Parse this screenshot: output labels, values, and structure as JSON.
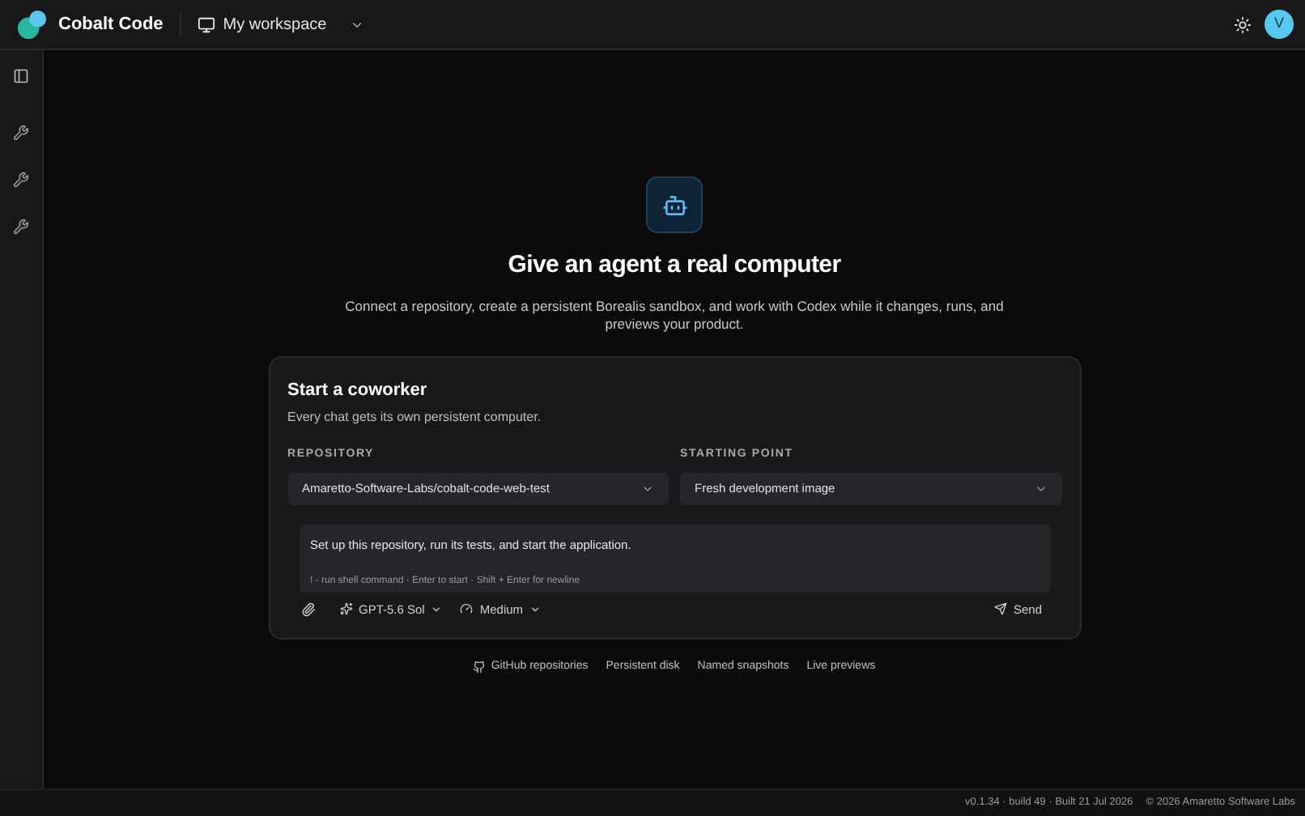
{
  "header": {
    "app_name": "Cobalt Code",
    "workspace": "My workspace",
    "avatar": "V"
  },
  "hero": {
    "title": "Give an agent a real computer",
    "subtitle": "Connect a repository, create a persistent Borealis sandbox, and work with Codex while it changes, runs, and previews your product."
  },
  "card": {
    "title": "Start a coworker",
    "subtitle": "Every chat gets its own persistent computer.",
    "fields": [
      {
        "label": "REPOSITORY",
        "value": "Amaretto-Software-Labs/cobalt-code-web-test"
      },
      {
        "label": "STARTING POINT",
        "value": "Fresh development image"
      }
    ],
    "prompt": {
      "value": "Set up this repository, run its tests, and start the application.",
      "hint": "! - run shell command · Enter to start · Shift + Enter for newline"
    },
    "model": "GPT-5.6 Sol",
    "effort": "Medium",
    "send": "Send"
  },
  "features": [
    {
      "label": "GitHub repositories",
      "kind": "github"
    },
    {
      "label": "Persistent disk",
      "kind": "plain"
    },
    {
      "label": "Named snapshots",
      "kind": "plain"
    },
    {
      "label": "Live previews",
      "kind": "plain"
    }
  ],
  "footer": {
    "version": "v0.1.34 · build 49 · Built 21 Jul 2026",
    "copyright": "© 2026 Amaretto Software Labs"
  }
}
